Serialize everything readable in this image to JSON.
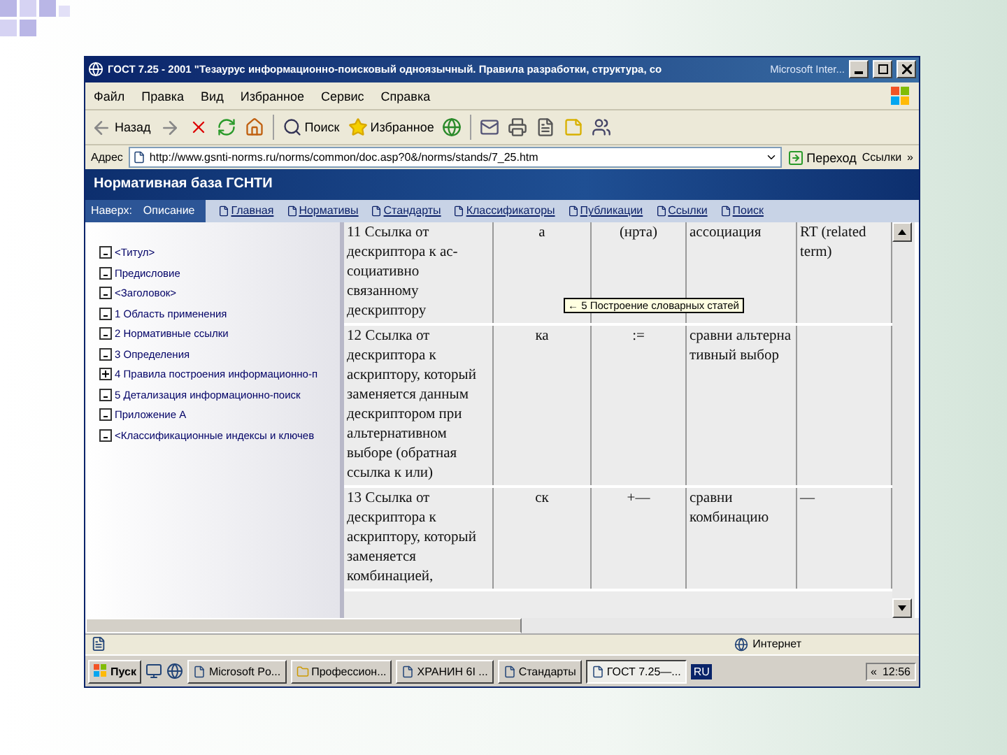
{
  "window": {
    "title": "ГОСТ 7.25 - 2001 \"Тезаурус информационно-поисковый одноязычный. Правила разработки, структура, со",
    "title_tail": "Microsoft Inter..."
  },
  "menu": [
    "Файл",
    "Правка",
    "Вид",
    "Избранное",
    "Сервис",
    "Справка"
  ],
  "toolbar": {
    "back": "Назад",
    "search": "Поиск",
    "favorites": "Избранное"
  },
  "address": {
    "label": "Адрес",
    "value": "http://www.gsnti-norms.ru/norms/common/doc.asp?0&/norms/stands/7_25.htm",
    "go": "Переход",
    "links": "Ссылки",
    "more": "»"
  },
  "site": {
    "title": "Нормативная база ГСНТИ",
    "nav": [
      {
        "label": "Наверх:",
        "kind": "section"
      },
      {
        "label": "Описание",
        "kind": "section"
      },
      {
        "label": "Главная",
        "kind": "page"
      },
      {
        "label": "Нормативы",
        "kind": "page"
      },
      {
        "label": "Стандарты",
        "kind": "page"
      },
      {
        "label": "Классификаторы",
        "kind": "page"
      },
      {
        "label": "Публикации",
        "kind": "page"
      },
      {
        "label": "Ссылки",
        "kind": "page"
      },
      {
        "label": "Поиск",
        "kind": "page"
      }
    ]
  },
  "tree": [
    {
      "label": "<Титул>",
      "expandable": false
    },
    {
      "label": "Предисловие",
      "expandable": false
    },
    {
      "label": "<Заголовок>",
      "expandable": false
    },
    {
      "label": "1 Область применения",
      "expandable": false
    },
    {
      "label": "2 Нормативные ссылки",
      "expandable": false
    },
    {
      "label": "3 Определения",
      "expandable": false
    },
    {
      "label": "4 Правила построения информационно-п",
      "expandable": true
    },
    {
      "label": "5 Детализация информационно-поиск",
      "expandable": false
    },
    {
      "label": "Приложение А",
      "expandable": false
    },
    {
      "label": "<Классификационные индексы и ключев",
      "expandable": false
    }
  ],
  "table": {
    "rows": [
      {
        "cells": [
          "11 Ссылка от дескриптора к ас-социативно связанному дескриптору",
          "а",
          "(нрта)",
          "ассоциация",
          "RT (related term)"
        ]
      },
      {
        "cells": [
          "12 Ссылка от дескриптора к аскриптору, который заменяется данным дескриптором при альтернативном выборе (обратная ссылка к или)",
          "ка",
          ":=",
          "сравни альтерна тивный выбор",
          ""
        ]
      },
      {
        "cells": [
          "13 Ссылка от дескриптора к аскриптору, который заменяется комбинацией,",
          "ск",
          "+—",
          "сравни комбинацию",
          "—"
        ]
      }
    ]
  },
  "tooltip": "← 5 Построение словарных статей",
  "status_bar": {
    "zone": "Интернет"
  },
  "taskbar": {
    "start": "Пуск",
    "tasks": [
      {
        "label": "Microsoft Po...",
        "selected": false
      },
      {
        "label": "Профессион...",
        "selected": false
      },
      {
        "label": "ХРАНИН 6I ...",
        "selected": false
      },
      {
        "label": "Стандарты",
        "selected": false
      },
      {
        "label": "ГОСТ 7.25—...",
        "selected": true
      }
    ],
    "language": "RU",
    "tray_toggle": "«",
    "clock": "12:56"
  }
}
